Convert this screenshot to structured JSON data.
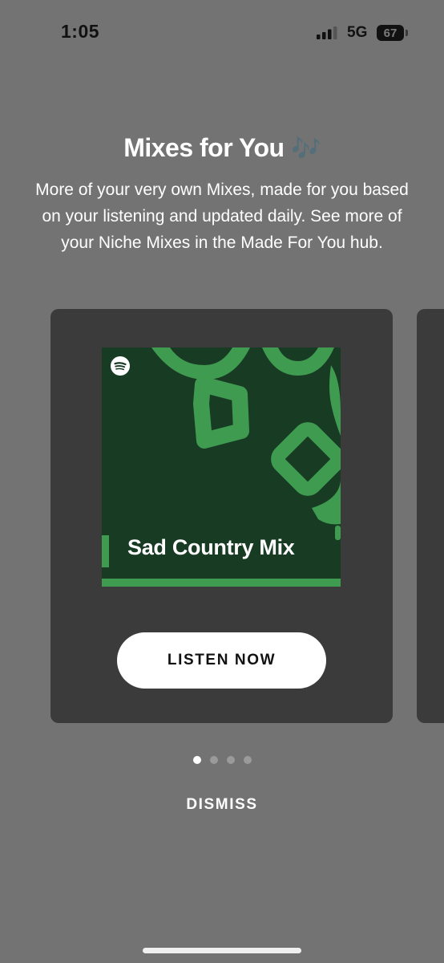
{
  "status_bar": {
    "time": "1:05",
    "network": "5G",
    "battery": "67"
  },
  "promo": {
    "title": "Mixes for You",
    "title_emoji": "🎶",
    "description": "More of your very own Mixes, made for you based on your listening and updated daily. See more of your Niche Mixes in the Made For You hub."
  },
  "card": {
    "cover_title": "Sad Country Mix",
    "button_label": "LISTEN NOW"
  },
  "pagination": {
    "count": 4,
    "active_index": 0
  },
  "dismiss_label": "DISMISS",
  "colors": {
    "background": "#737373",
    "card": "#3b3b3b",
    "cover_dark": "#183b24",
    "cover_accent": "#3f9b4f"
  }
}
